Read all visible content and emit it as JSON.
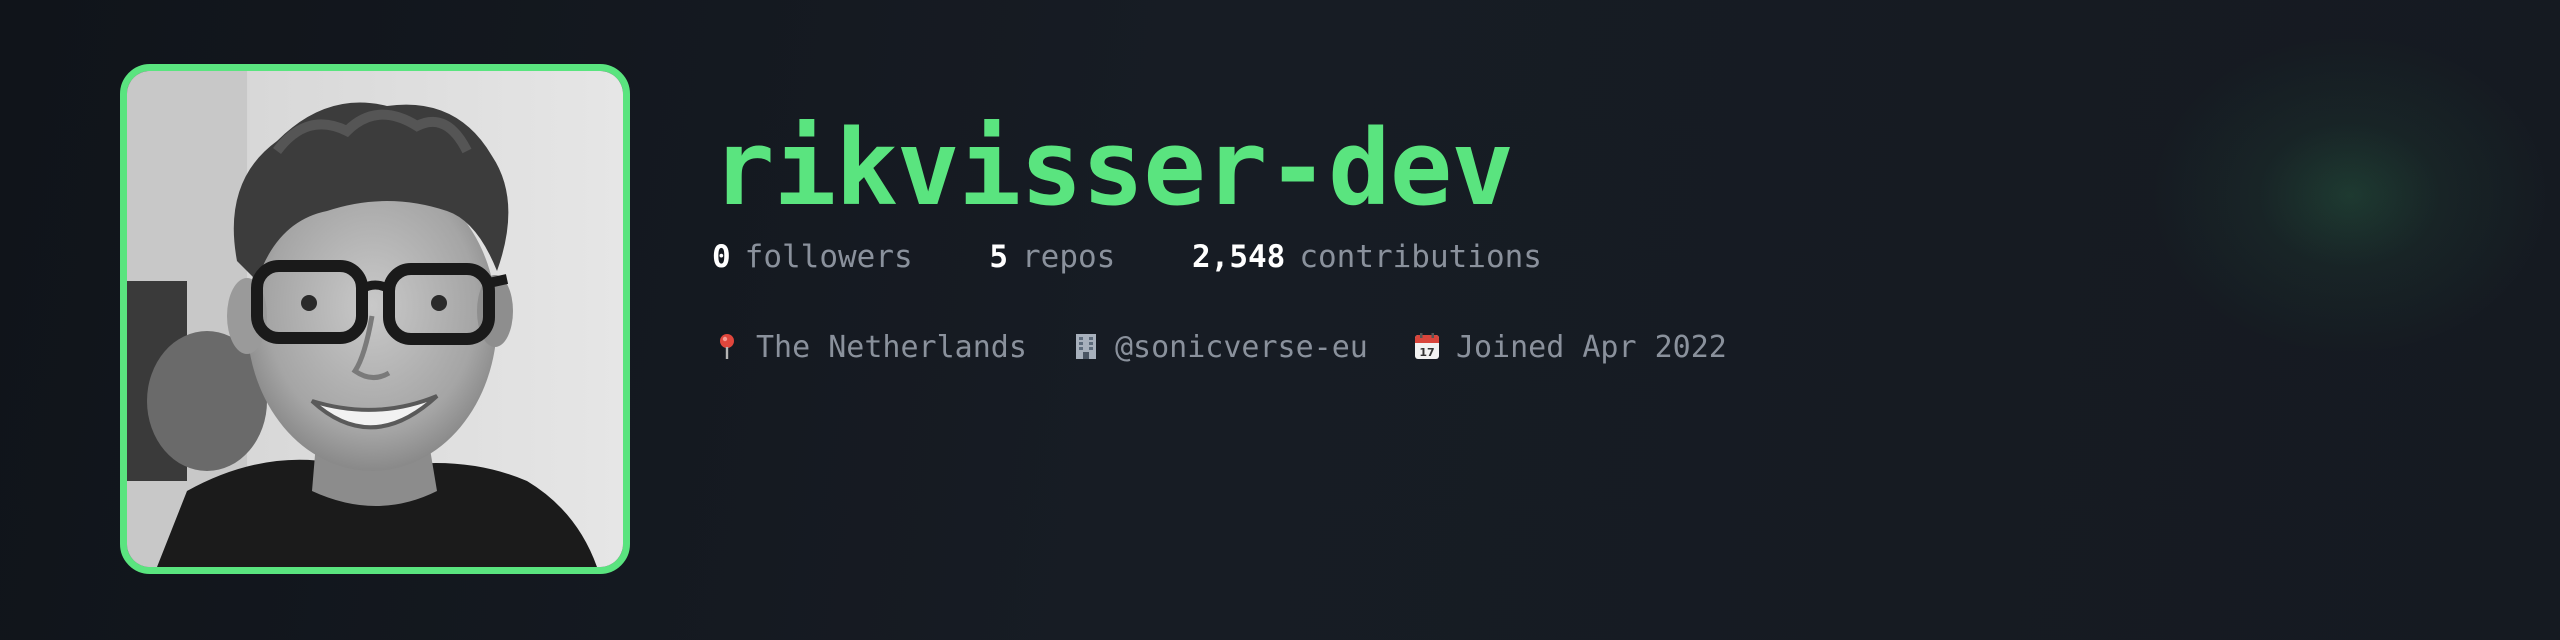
{
  "profile": {
    "username": "rikvisser-dev",
    "avatar_icon": "avatar-photo",
    "accent_color": "#5ae47f",
    "stats": [
      {
        "value": "0",
        "label": "followers"
      },
      {
        "value": "5",
        "label": "repos"
      },
      {
        "value": "2,548",
        "label": "contributions"
      }
    ],
    "meta": [
      {
        "icon": "pin-icon",
        "text": "The Netherlands"
      },
      {
        "icon": "building-icon",
        "text": "@sonicverse-eu"
      },
      {
        "icon": "calendar-icon",
        "text": "Joined Apr 2022"
      }
    ]
  }
}
